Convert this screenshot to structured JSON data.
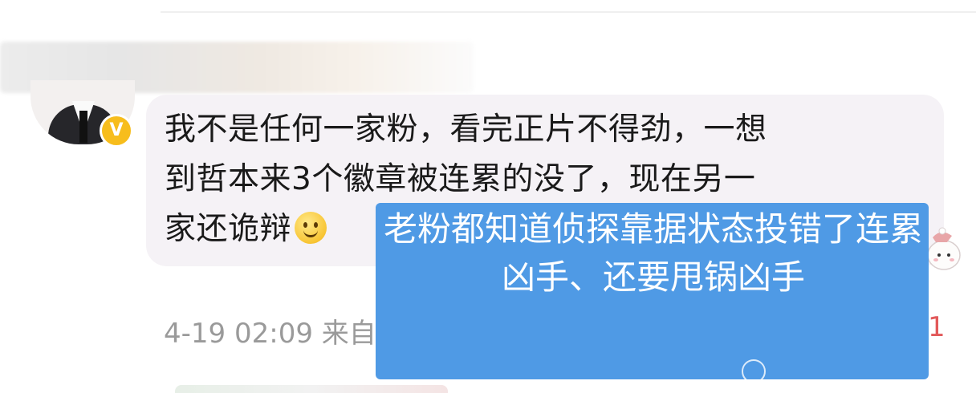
{
  "comment": {
    "lines": [
      "我不是任何一家粉，看完正片不得劲，一想",
      "到哲本来3个徽章被连累的没了，现在另一",
      "家还诡辩"
    ],
    "emoji": "smile-emoji",
    "meta": "4-19 02:09  来自",
    "meta_right": "1"
  },
  "author": {
    "verified_badge": "V"
  },
  "overlay": {
    "text": "老粉都知道侦探靠据状态投错了连累凶手、还要甩锅凶手"
  },
  "colors": {
    "bubble": "#f5f2f6",
    "overlay": "#4f9ae5",
    "verified": "#f7bd1c",
    "meta": "#9a9a9a",
    "accent_red": "#e2595a"
  }
}
